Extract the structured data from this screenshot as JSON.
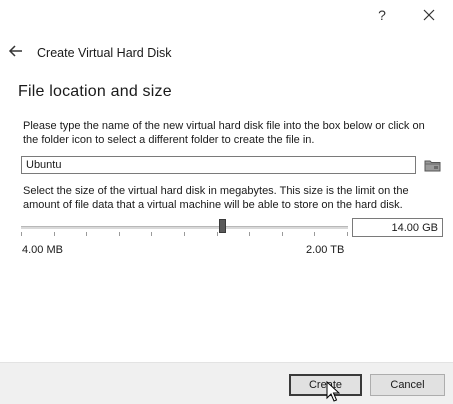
{
  "titlebar": {
    "help_label": "?",
    "close_icon": "close-icon"
  },
  "header": {
    "back_icon": "back-arrow-icon",
    "title": "Create Virtual Hard Disk"
  },
  "page": {
    "title": "File location and size",
    "location_description": "Please type the name of the new virtual hard disk file into the box below or click on the folder icon to select a different folder to create the file in.",
    "location_value": "Ubuntu",
    "folder_icon": "folder-icon",
    "size_description": "Select the size of the virtual hard disk in megabytes. This size is the limit on the amount of file data that a virtual machine will be able to store on the hard disk.",
    "size_value": "14.00 GB",
    "slider_fraction": 0.615,
    "range_min": "4.00 MB",
    "range_max": "2.00 TB"
  },
  "footer": {
    "create_label": "Create",
    "cancel_label": "Cancel"
  },
  "colors": {
    "footer_bg": "#f0f0f0",
    "button_bg": "#e1e1e1"
  }
}
